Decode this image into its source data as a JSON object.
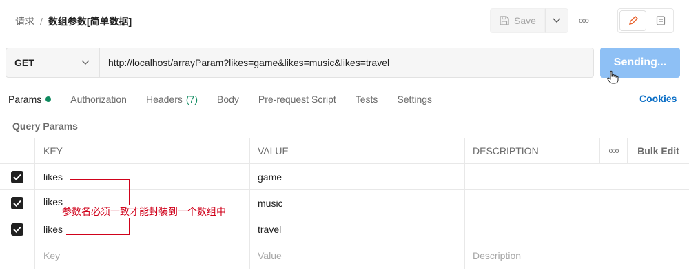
{
  "breadcrumb": {
    "parent": "请求",
    "separator": "/",
    "current": "数组参数[简单数据]"
  },
  "toolbar": {
    "save_label": "Save",
    "more_glyph": "ooo"
  },
  "request": {
    "method": "GET",
    "url": "http://localhost/arrayParam?likes=game&likes=music&likes=travel",
    "send_label": "Sending..."
  },
  "tabs": [
    {
      "label": "Params"
    },
    {
      "label": "Authorization"
    },
    {
      "label": "Headers",
      "count": "(7)"
    },
    {
      "label": "Body"
    },
    {
      "label": "Pre-request Script"
    },
    {
      "label": "Tests"
    },
    {
      "label": "Settings"
    }
  ],
  "cookies_label": "Cookies",
  "query_params": {
    "title": "Query Params",
    "columns": {
      "key": "KEY",
      "value": "VALUE",
      "description": "DESCRIPTION",
      "more": "ooo",
      "bulk_edit": "Bulk Edit"
    },
    "rows": [
      {
        "checked": true,
        "key": "likes",
        "value": "game",
        "description": ""
      },
      {
        "checked": true,
        "key": "likes",
        "value": "music",
        "description": ""
      },
      {
        "checked": true,
        "key": "likes",
        "value": "travel",
        "description": ""
      }
    ],
    "placeholders": {
      "key": "Key",
      "value": "Value",
      "description": "Description"
    }
  },
  "annotation": {
    "text": "参数名必须一致才能封装到一个数组中",
    "color": "#d0021b"
  },
  "colors": {
    "accent_blue": "#0c6fc6",
    "send_button": "#8ec0f5",
    "active_dot": "#0f8a5f",
    "annotation_red": "#d0021b"
  }
}
